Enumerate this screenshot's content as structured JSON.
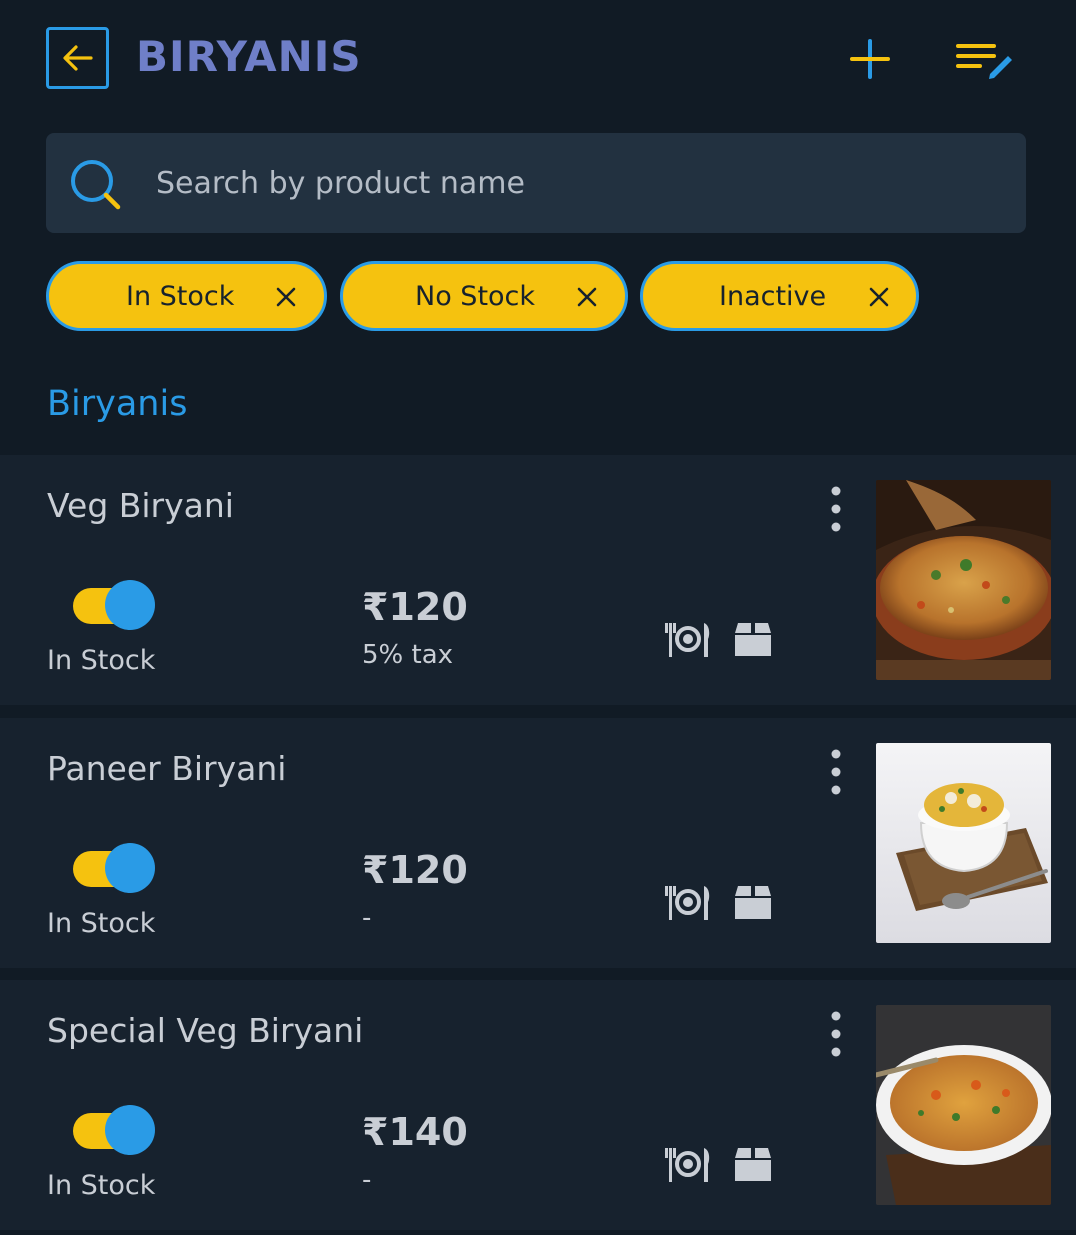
{
  "header": {
    "title": "BIRYANIS"
  },
  "search": {
    "placeholder": "Search by product name"
  },
  "filters": [
    {
      "label": "In Stock"
    },
    {
      "label": "No Stock"
    },
    {
      "label": "Inactive"
    }
  ],
  "section": {
    "title": "Biryanis"
  },
  "products": [
    {
      "name": "Veg Biryani",
      "stock_status": "In Stock",
      "in_stock": true,
      "price": "₹120",
      "tax": "5% tax"
    },
    {
      "name": "Paneer Biryani",
      "stock_status": "In Stock",
      "in_stock": true,
      "price": "₹120",
      "tax": "-"
    },
    {
      "name": "Special Veg Biryani",
      "stock_status": "In Stock",
      "in_stock": true,
      "price": "₹140",
      "tax": "-"
    }
  ],
  "icons": {
    "back": "arrow-left-icon",
    "add": "plus-icon",
    "edit_list": "edit-list-icon",
    "search": "search-icon",
    "chip_close": "close-icon",
    "more": "more-vertical-icon",
    "dine_in": "dine-in-icon",
    "delivery": "box-icon"
  },
  "colors": {
    "background": "#111b25",
    "card": "#17222e",
    "accent_blue": "#2a9be6",
    "accent_yellow": "#f5c20f",
    "title_purple": "#6f7fc8",
    "text": "#c9ced5"
  }
}
